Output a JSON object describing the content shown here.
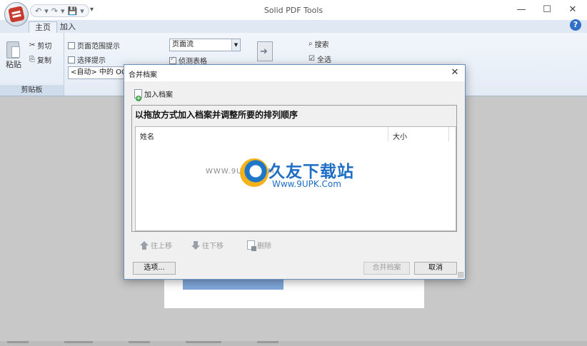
{
  "app": {
    "title": "Solid PDF Tools",
    "quick_access": [
      "↶",
      "▾",
      "↷",
      "▾",
      "💾",
      "▾"
    ],
    "qat_more": "▾"
  },
  "window_controls": {
    "minimize": "—",
    "maximize": "☐",
    "close": "✕"
  },
  "tabs": [
    {
      "label": "主页",
      "active": true
    },
    {
      "label": "加入",
      "active": false
    }
  ],
  "help_label": "?",
  "ribbon": {
    "clipboard": {
      "paste_label": "粘贴",
      "cut_label": "剪切",
      "copy_label": "复制",
      "group_label": "剪贴板"
    },
    "options": {
      "page_range_label": "页面范围提示",
      "select_hint_label": "选择提示",
      "ocr_combo_value": "<自动> 中的 OC",
      "flow_combo_value": "页面流",
      "detect_tables_label": "侦测表格"
    },
    "find": {
      "search_label": "搜索",
      "select_all_label": "全选"
    }
  },
  "dialog": {
    "title": "合并档案",
    "close": "✕",
    "add_files_label": "加入档案",
    "heading": "以拖放方式加入档案并调整所要的排列顺序",
    "columns": {
      "name": "姓名",
      "size": "大小"
    },
    "rows": [],
    "move_up_label": "往上移",
    "move_down_label": "往下移",
    "delete_label": "删除",
    "options_button": "选项...",
    "combine_button": "合并档案",
    "cancel_button": "取消"
  },
  "watermark": {
    "url_left": "WWW.9UPK.COM",
    "brand": "久友下载站",
    "url": "Www.9UPK.Com"
  },
  "colors": {
    "accent": "#2f6fc6",
    "ribbon_bg": "#e3ebf5",
    "workspace_bg": "#c8c8c8",
    "selection": "#7fa7da"
  }
}
